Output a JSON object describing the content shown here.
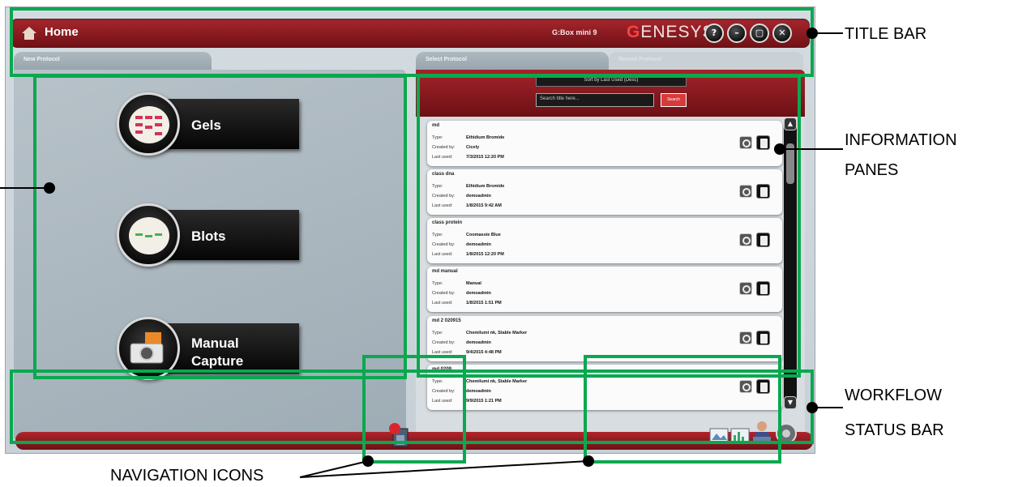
{
  "app": {
    "title": "Home",
    "device": "G:Box mini 9",
    "brand_g": "G",
    "brand_rest": "ENESYS",
    "window_buttons": [
      "?",
      "–",
      "▢",
      "✕"
    ]
  },
  "tabs": {
    "new_protocol": "New Protocol",
    "select_protocol": "Select Protocol",
    "recent_protocol": "Recent Protocol"
  },
  "protocols": [
    {
      "label": "Gels"
    },
    {
      "label": "Blots"
    },
    {
      "label": "Manual",
      "label2": "Capture"
    }
  ],
  "search": {
    "sort_label": "Sort by Last Used (Desc)",
    "placeholder": "Search title here...",
    "button": "Search"
  },
  "field_labels": {
    "type": "Type:",
    "created_by": "Created by:",
    "last_used": "Last used:"
  },
  "protocol_list": [
    {
      "name": "md",
      "type": "Ethidium Bromide",
      "created_by": "Cicely",
      "last_used": "7/3/2015 12:20 PM"
    },
    {
      "name": "class dna",
      "type": "Ethidium Bromide",
      "created_by": "demoadmin",
      "last_used": "1/8/2015 9:42 AM"
    },
    {
      "name": "class protein",
      "type": "Coomassie Blue",
      "created_by": "demoadmin",
      "last_used": "1/8/2015 12:20 PM"
    },
    {
      "name": "md manual",
      "type": "Manual",
      "created_by": "demoadmin",
      "last_used": "1/8/2015 1:51 PM"
    },
    {
      "name": "md 2 020915",
      "type": "Chemilumi nk, Stable Marker",
      "created_by": "demoadmin",
      "last_used": "9/4/2015 4:48 PM"
    },
    {
      "name": "md 0209",
      "type": "Chemilumi nk, Stable Marker",
      "created_by": "demoadmin",
      "last_used": "9/9/2015 1:21 PM"
    }
  ],
  "annotations": {
    "title_bar": "TITLE BAR",
    "information_panes_1": "INFORMATION",
    "information_panes_2": "PANES",
    "workflow_1": "WORKFLOW",
    "workflow_2": "STATUS BAR",
    "navigation_icons": "NAVIGATION ICONS"
  },
  "colors": {
    "brand_red": "#a8262c",
    "annotation_green": "#0aa84f",
    "panel_gray": "#c7d0d6"
  }
}
